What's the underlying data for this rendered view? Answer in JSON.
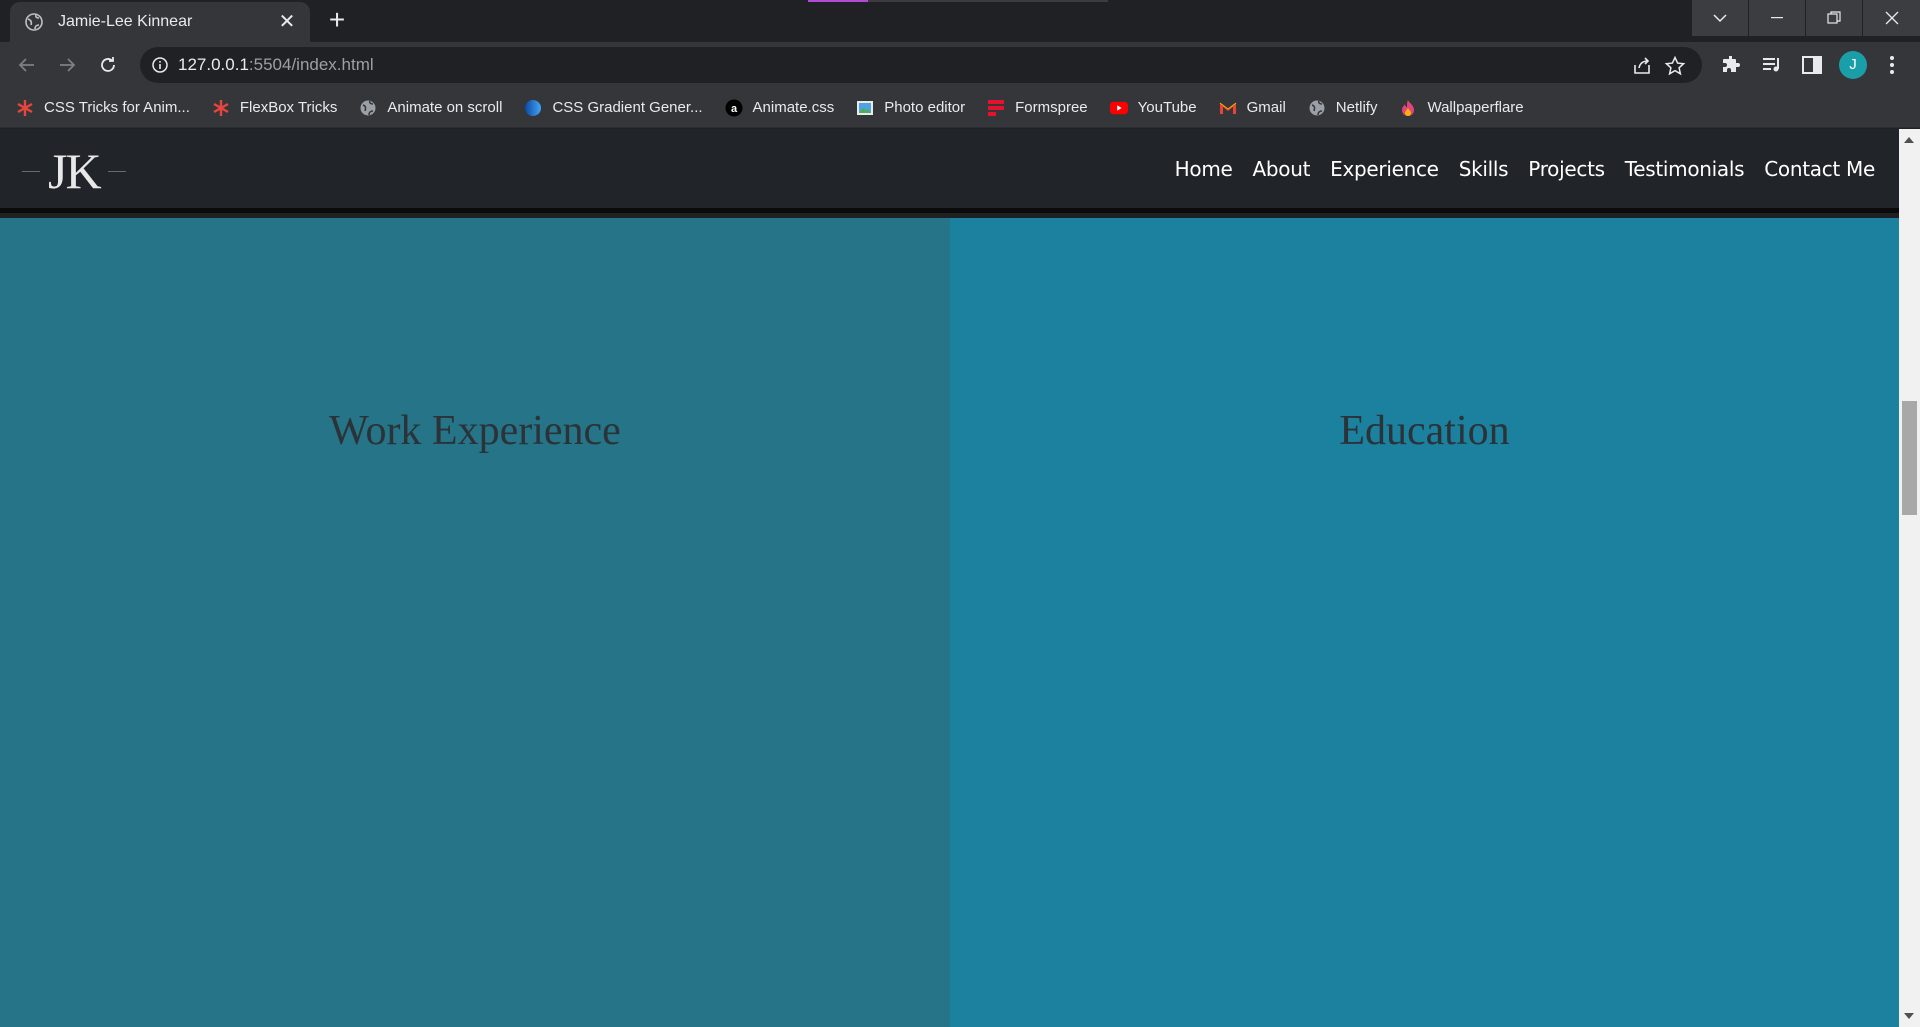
{
  "browser": {
    "tab": {
      "title": "Jamie-Lee Kinnear",
      "close_glyph": "✕",
      "icon": "globe-icon"
    },
    "new_tab_glyph": "+",
    "url": {
      "host": "127.0.0.1",
      "rest": ":5504/index.html"
    },
    "profile_initial": "J",
    "bookmarks": [
      {
        "label": "CSS Tricks for Anim...",
        "icon": "asterisk-icon",
        "color": "#e8453c"
      },
      {
        "label": "FlexBox Tricks",
        "icon": "asterisk-icon",
        "color": "#e8453c"
      },
      {
        "label": "Animate on scroll",
        "icon": "globe-icon",
        "color": "#9aa0a6"
      },
      {
        "label": "CSS Gradient Gener...",
        "icon": "gradient-icon",
        "color": "#1565c0"
      },
      {
        "label": "Animate.css",
        "icon": "amazon-icon",
        "color": "#000000"
      },
      {
        "label": "Photo editor",
        "icon": "image-icon",
        "color": "#4fa3e0"
      },
      {
        "label": "Formspree",
        "icon": "formspree-icon",
        "color": "#e5122e"
      },
      {
        "label": "YouTube",
        "icon": "youtube-icon",
        "color": "#ff0000"
      },
      {
        "label": "Gmail",
        "icon": "gmail-icon",
        "color": "#ea4335"
      },
      {
        "label": "Netlify",
        "icon": "globe-icon",
        "color": "#9aa0a6"
      },
      {
        "label": "Wallpaperflare",
        "icon": "flame-icon",
        "color": "#e0457b"
      }
    ]
  },
  "site": {
    "logo": "JK",
    "nav": [
      "Home",
      "About",
      "Experience",
      "Skills",
      "Projects",
      "Testimonials",
      "Contact Me"
    ],
    "sections": {
      "left_title": "Work Experience",
      "right_title": "Education"
    },
    "colors": {
      "header": "#212428",
      "left_panel": "#267487",
      "right_panel": "#1b819e"
    }
  }
}
